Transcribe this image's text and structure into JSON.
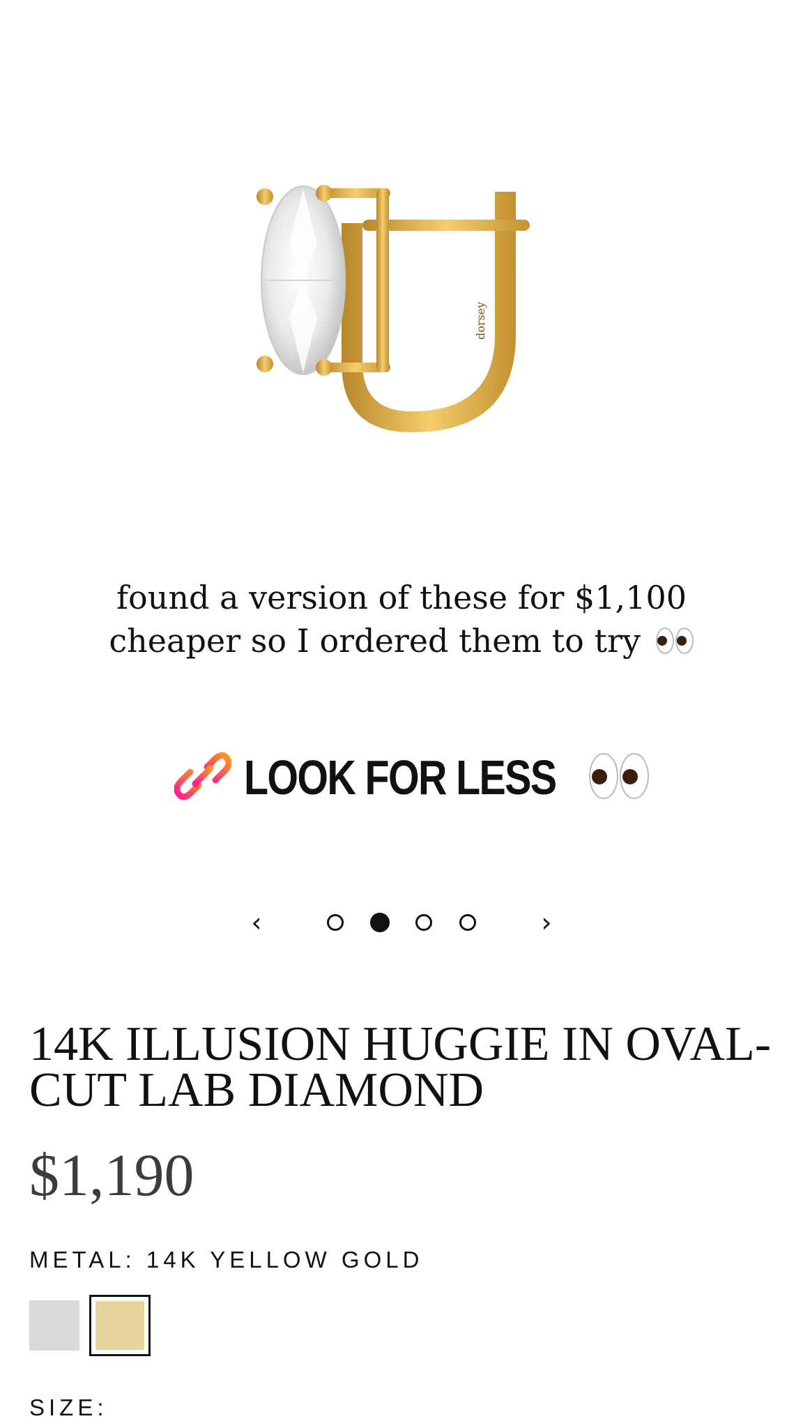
{
  "caption": {
    "line1": "found a version of these for $1,100",
    "line2": "cheaper so I ordered them to try",
    "emoji": "eyes-emoji"
  },
  "link_sticker": {
    "label": "LOOK FOR LESS",
    "icon": "link-icon",
    "emoji": "eyes-emoji",
    "gradient_start": "#ff1b8d",
    "gradient_end": "#ff9b1a"
  },
  "product_image": {
    "engraving": "dorsey",
    "metal_color": "#e2b04e"
  },
  "carousel": {
    "prev_icon": "chevron-left-icon",
    "next_icon": "chevron-right-icon",
    "total_slides": 4,
    "active_slide": 2
  },
  "product": {
    "title": "14K ILLUSION HUGGIE IN OVAL-CUT LAB DIAMOND",
    "price": "$1,190",
    "metal_label": "METAL: 14K YELLOW GOLD",
    "swatches": [
      {
        "name": "silver",
        "color": "#d9d9d9",
        "selected": false
      },
      {
        "name": "yellow-gold",
        "color": "#e8d49c",
        "selected": true
      }
    ],
    "size_label": "SIZE:"
  }
}
